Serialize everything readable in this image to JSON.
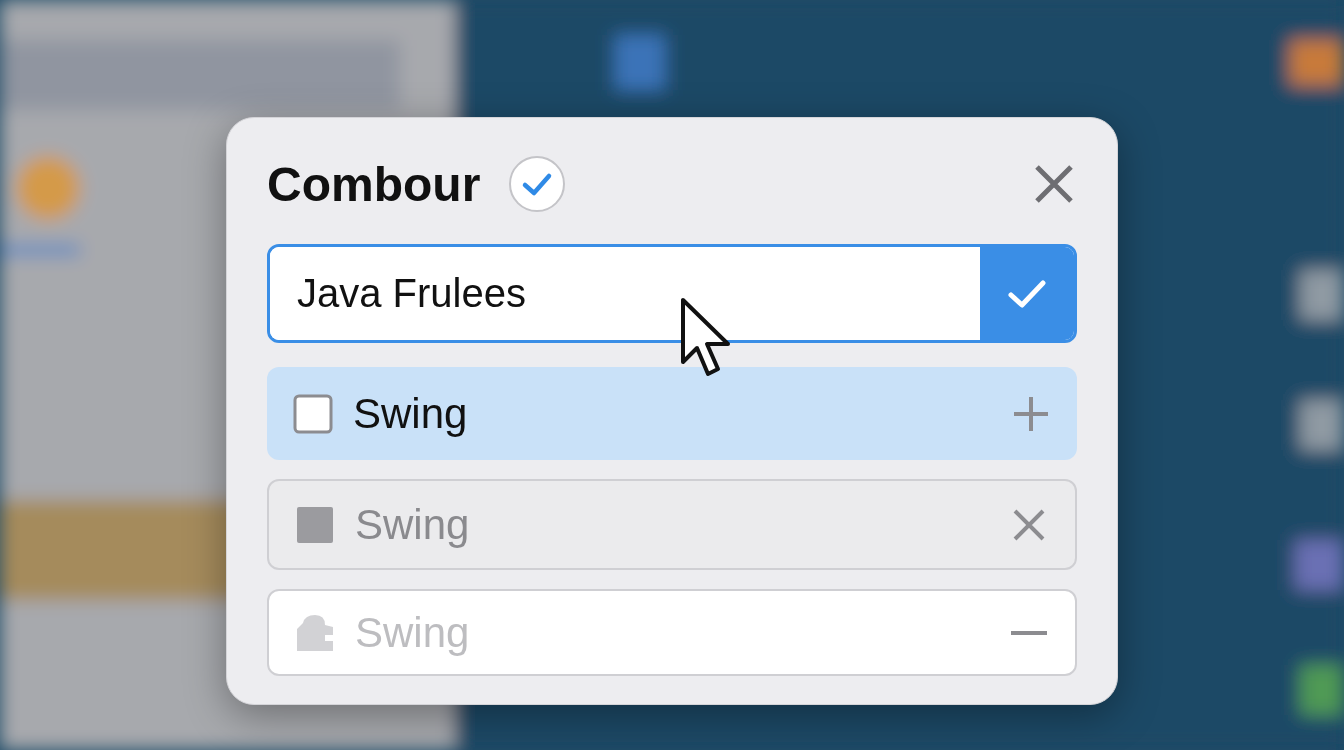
{
  "dialog": {
    "title": "Combour",
    "title_verified": true,
    "field": {
      "value": "Java Frulees",
      "focused": true
    },
    "options": [
      {
        "kind": "highlighted",
        "label": "Swing",
        "checked": false
      },
      {
        "kind": "muted",
        "label": "Swing"
      },
      {
        "kind": "disabled",
        "label": "Swing"
      }
    ]
  }
}
